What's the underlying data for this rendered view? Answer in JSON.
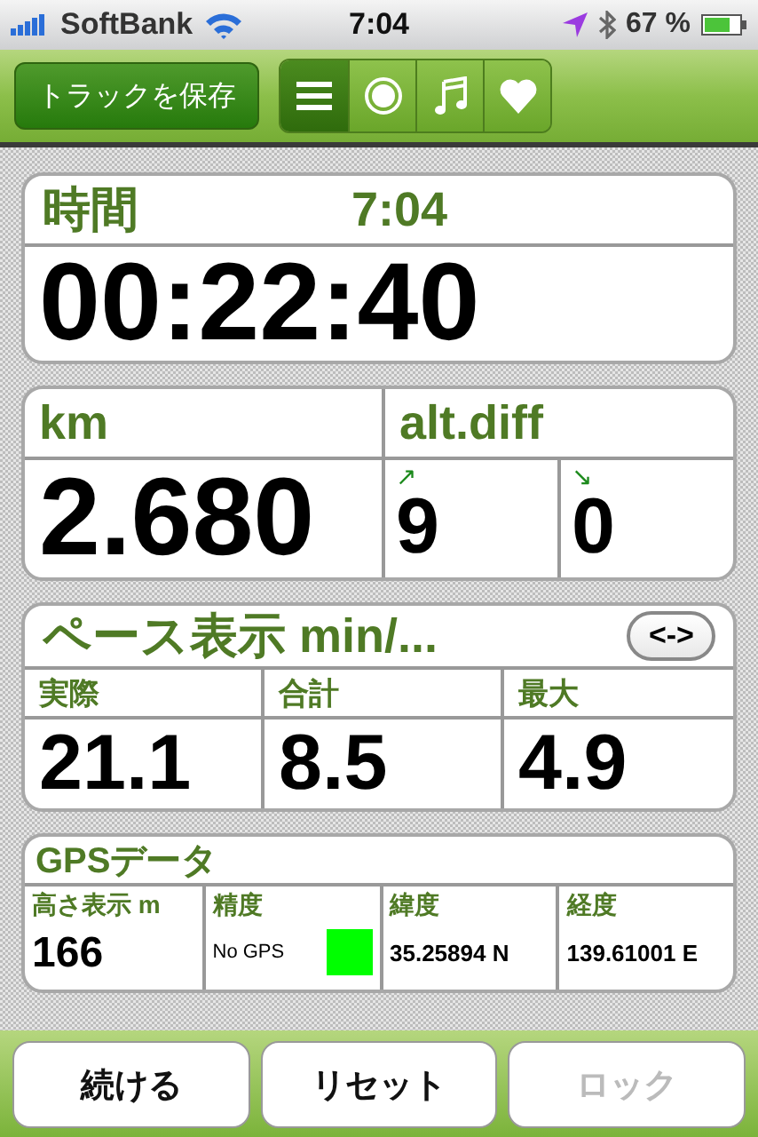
{
  "status_bar": {
    "carrier": "SoftBank",
    "time": "7:04",
    "battery": "67 %"
  },
  "toolbar": {
    "save_button": "トラックを保存",
    "segments": [
      {
        "kind": "list",
        "selected": true
      },
      {
        "kind": "record",
        "selected": false
      },
      {
        "kind": "music",
        "selected": false
      },
      {
        "kind": "heart",
        "selected": false
      }
    ]
  },
  "time_card": {
    "label": "時間",
    "clock": "7:04",
    "value": "00:22:40"
  },
  "distance_card": {
    "label": "km",
    "value": "2.680",
    "alt_label": "alt.diff",
    "up_arrow": "↗",
    "up": "9",
    "down_arrow": "↘",
    "down": "0"
  },
  "pace_card": {
    "title": "ペース表示 min/...",
    "toggle": "<->",
    "cells": [
      {
        "label": "実際",
        "value": "21.1"
      },
      {
        "label": "合計",
        "value": "8.5"
      },
      {
        "label": "最大",
        "value": "4.9"
      }
    ]
  },
  "gps_card": {
    "title": "GPSデータ",
    "altitude": {
      "label": "高さ表示 m",
      "value": "166"
    },
    "accuracy": {
      "label": "精度",
      "value": "No GPS",
      "color": "#00ff00"
    },
    "coords": [
      {
        "label": "緯度",
        "value": "35.25894 N"
      },
      {
        "label": "経度",
        "value": "139.61001 E"
      }
    ]
  },
  "buttons": [
    {
      "label": "続ける",
      "disabled": false
    },
    {
      "label": "リセット",
      "disabled": false
    },
    {
      "label": "ロック",
      "disabled": true
    }
  ]
}
